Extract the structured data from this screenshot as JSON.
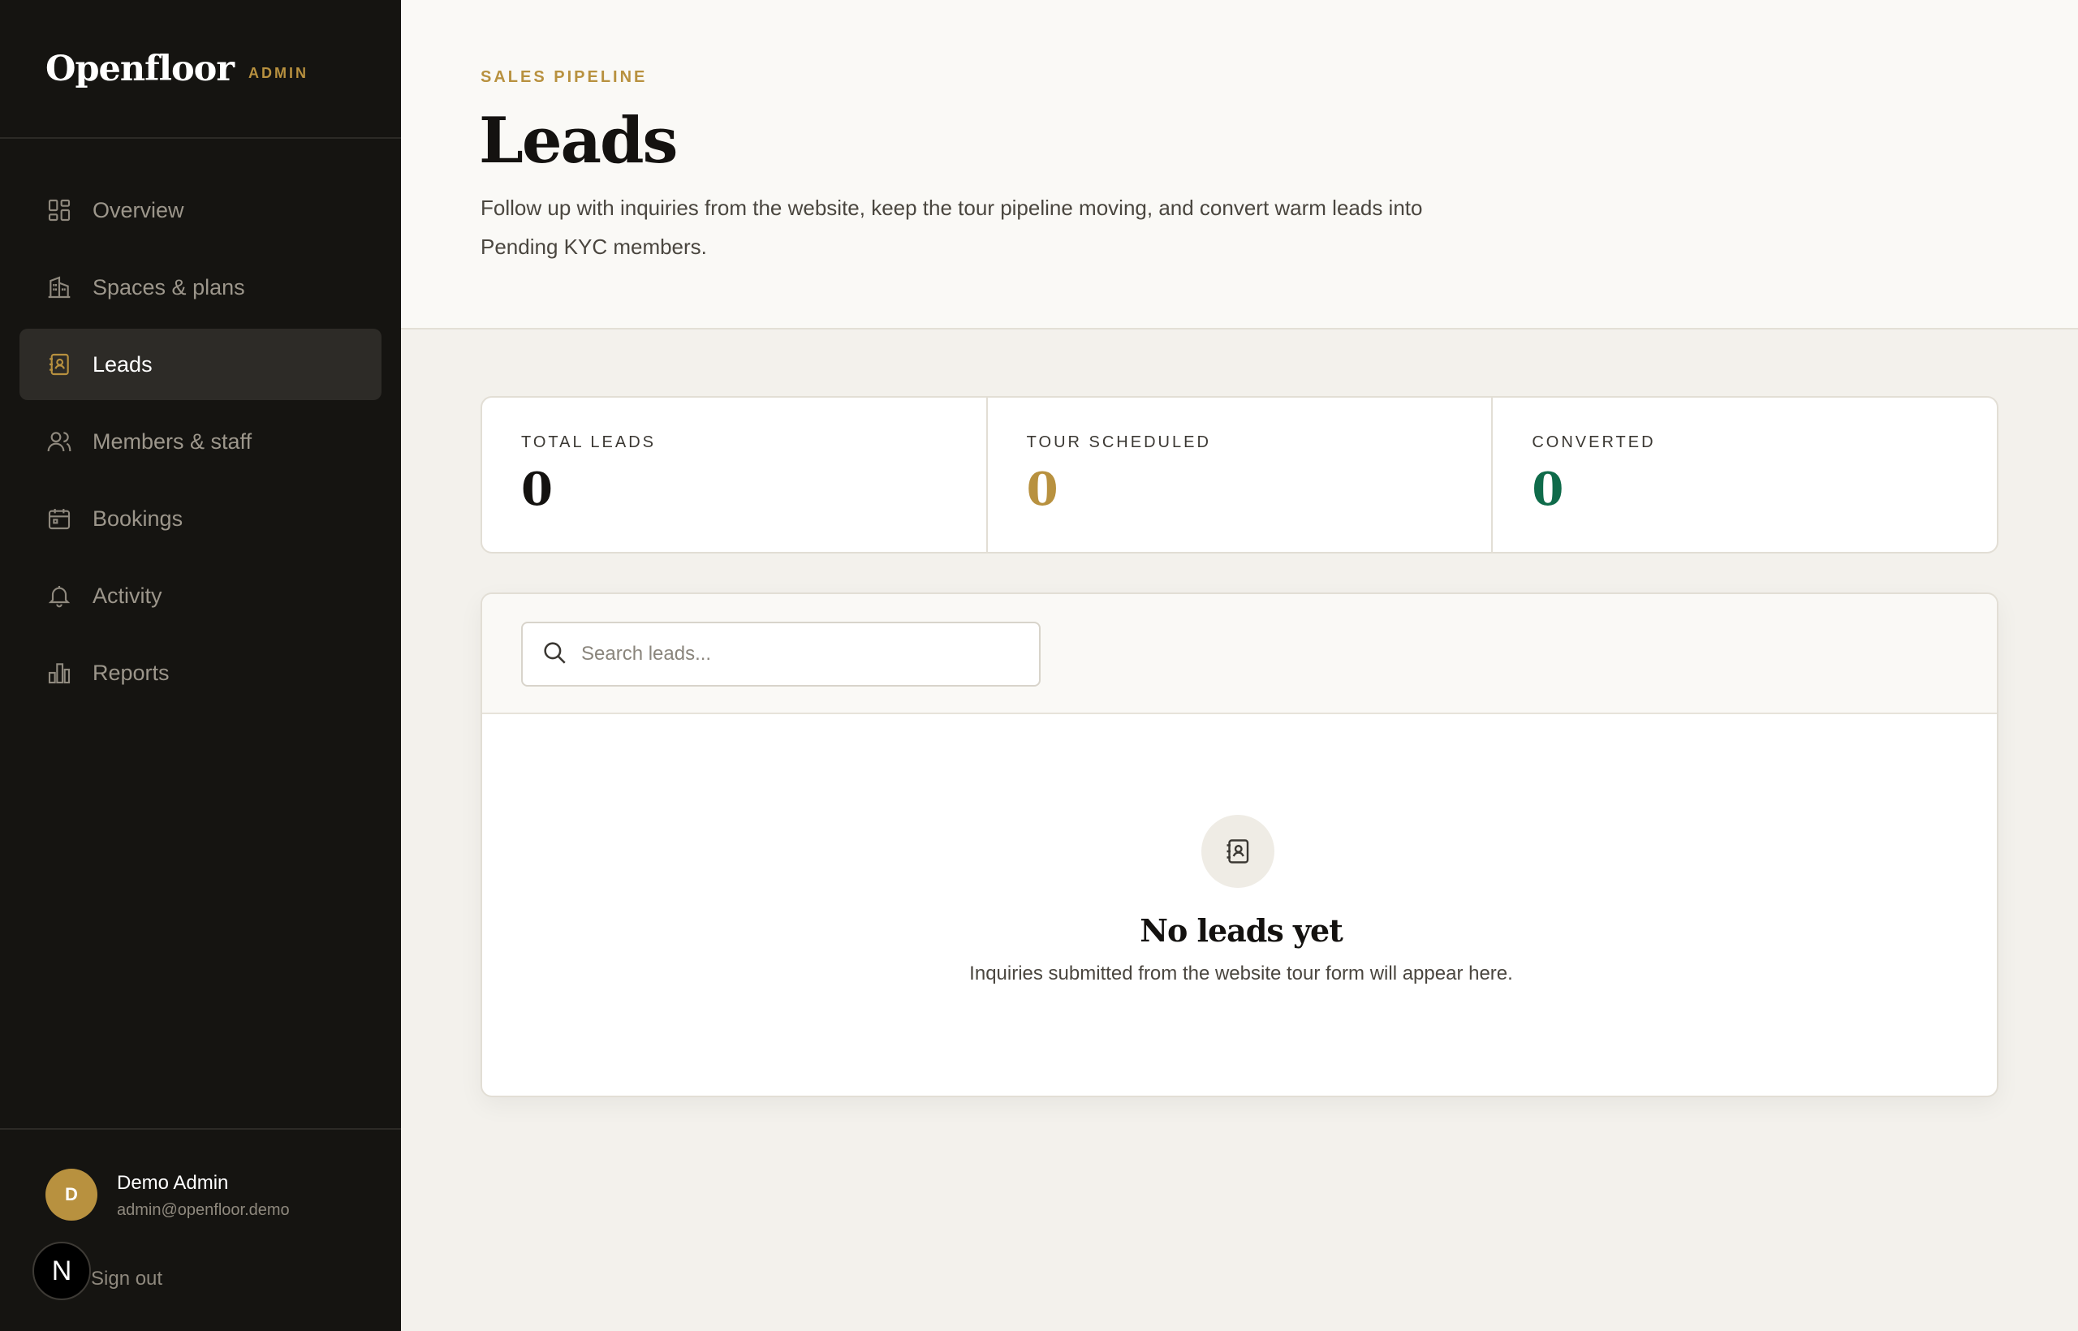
{
  "brand": {
    "name": "Openfloor",
    "tag": "ADMIN"
  },
  "sidebar": {
    "items": [
      {
        "label": "Overview",
        "icon": "grid-icon",
        "active": false
      },
      {
        "label": "Spaces & plans",
        "icon": "building-icon",
        "active": false
      },
      {
        "label": "Leads",
        "icon": "contact-book-icon",
        "active": true
      },
      {
        "label": "Members & staff",
        "icon": "users-icon",
        "active": false
      },
      {
        "label": "Bookings",
        "icon": "calendar-icon",
        "active": false
      },
      {
        "label": "Activity",
        "icon": "bell-icon",
        "active": false
      },
      {
        "label": "Reports",
        "icon": "bar-chart-icon",
        "active": false
      }
    ]
  },
  "user": {
    "initial": "D",
    "name": "Demo Admin",
    "email": "admin@openfloor.demo",
    "signout": "Sign out",
    "badge": "N"
  },
  "header": {
    "eyebrow": "SALES PIPELINE",
    "title": "Leads",
    "description": "Follow up with inquiries from the website, keep the tour pipeline moving, and convert warm leads into Pending KYC members."
  },
  "stats": [
    {
      "label": "TOTAL LEADS",
      "value": "0",
      "color": "#141210"
    },
    {
      "label": "TOUR SCHEDULED",
      "value": "0",
      "color": "#b8913f"
    },
    {
      "label": "CONVERTED",
      "value": "0",
      "color": "#0f6b4a"
    }
  ],
  "search": {
    "placeholder": "Search leads...",
    "value": ""
  },
  "empty": {
    "title": "No leads yet",
    "subtitle": "Inquiries submitted from the website tour form will appear here."
  },
  "colors": {
    "accent": "#b8913f",
    "sidebar_bg": "#151411",
    "success": "#0f6b4a"
  }
}
